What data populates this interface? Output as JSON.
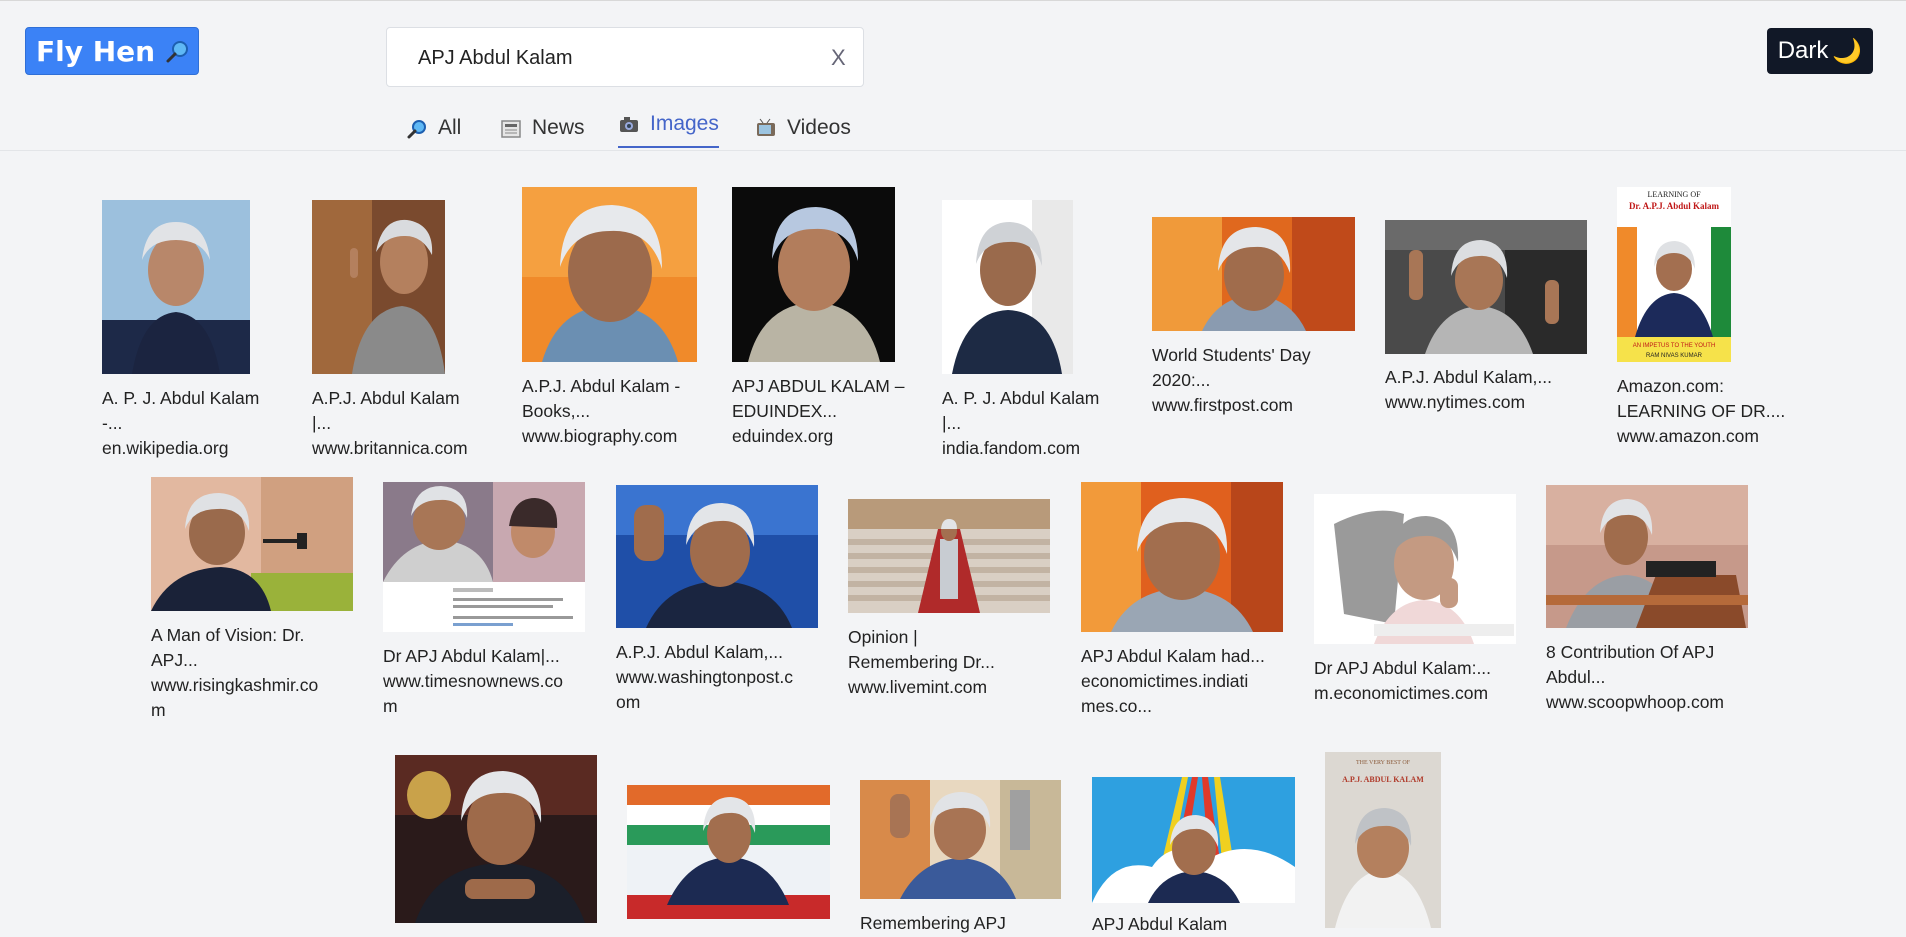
{
  "header": {
    "logo_text": "Fly Hen",
    "search_value": "APJ Abdul Kalam",
    "clear_label": "X",
    "theme_label": "Dark",
    "theme_icon": "🌙"
  },
  "tabs": [
    {
      "label": "All",
      "icon": "search-icon"
    },
    {
      "label": "News",
      "icon": "newspaper-icon"
    },
    {
      "label": "Images",
      "icon": "camera-icon",
      "active": true
    },
    {
      "label": "Videos",
      "icon": "tv-icon"
    }
  ],
  "results": [
    {
      "title": "A. P. J. Abdul Kalam -...",
      "domain": "en.wikipedia.org"
    },
    {
      "title": "A.P.J. Abdul Kalam |...",
      "domain": "www.britannica.com"
    },
    {
      "title": "A.P.J. Abdul Kalam -\nBooks,...",
      "domain": "www.biography.com"
    },
    {
      "title": "APJ ABDUL KALAM –\nEDUINDEX...",
      "domain": "eduindex.org"
    },
    {
      "title": "A. P. J. Abdul Kalam |...",
      "domain": "india.fandom.com"
    },
    {
      "title": "World Students' Day\n2020:...",
      "domain": "www.firstpost.com"
    },
    {
      "title": "A.P.J. Abdul Kalam,...",
      "domain": "www.nytimes.com"
    },
    {
      "title": "Amazon.com:\nLEARNING OF DR....",
      "domain": "www.amazon.com"
    },
    {
      "title": "A Man of Vision: Dr.\nAPJ...",
      "domain": "www.risingkashmir.co\nm"
    },
    {
      "title": "Dr APJ Abdul Kalam|...",
      "domain": "www.timesnownews.co\nm"
    },
    {
      "title": "A.P.J. Abdul Kalam,...",
      "domain": "www.washingtonpost.c\nom"
    },
    {
      "title": "Opinion |\nRemembering Dr...",
      "domain": "www.livemint.com"
    },
    {
      "title": "APJ Abdul Kalam had...",
      "domain": "economictimes.indiati\nmes.co..."
    },
    {
      "title": "Dr APJ Abdul Kalam:...",
      "domain": "m.economictimes.com"
    },
    {
      "title": "8 Contribution Of APJ\nAbdul...",
      "domain": "www.scoopwhoop.com"
    },
    {
      "title": "",
      "domain": ""
    },
    {
      "title": "",
      "domain": ""
    },
    {
      "title": "Remembering APJ",
      "domain": ""
    },
    {
      "title": "APJ Abdul Kalam",
      "domain": ""
    },
    {
      "title": "",
      "domain": ""
    }
  ],
  "book_cover": {
    "top": "LEARNING OF",
    "name": "Dr. A.P.J. Abdul Kalam",
    "tag": "AN IMPETUS TO THE YOUTH",
    "author": "RAM NIVAS KUMAR"
  },
  "book_cover_2": {
    "top": "THE VERY BEST OF",
    "name": "A.P.J. ABDUL KALAM"
  },
  "colors": {
    "accent": "#3b82f6",
    "active_tab": "#4465c9",
    "dark_button": "#111827"
  }
}
